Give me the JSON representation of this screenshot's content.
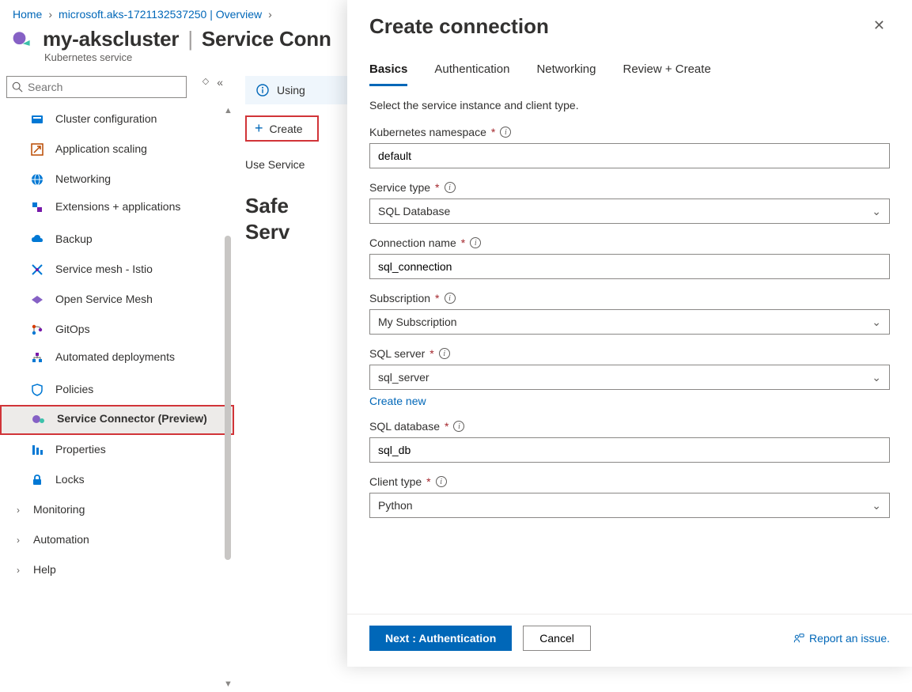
{
  "breadcrumb": {
    "home": "Home",
    "project": "microsoft.aks-1721132537250 | Overview"
  },
  "title": {
    "resource": "my-akscluster",
    "section": "Service Conn",
    "subtitle": "Kubernetes service"
  },
  "sidebar": {
    "search_placeholder": "Search",
    "items": [
      {
        "label": "Cluster configuration"
      },
      {
        "label": "Application scaling"
      },
      {
        "label": "Networking"
      },
      {
        "label": "Extensions + applications"
      },
      {
        "label": "Backup"
      },
      {
        "label": "Service mesh - Istio"
      },
      {
        "label": "Open Service Mesh"
      },
      {
        "label": "GitOps"
      },
      {
        "label": "Automated deployments"
      },
      {
        "label": "Policies"
      },
      {
        "label": "Service Connector (Preview)"
      },
      {
        "label": "Properties"
      },
      {
        "label": "Locks"
      }
    ],
    "groups": [
      {
        "label": "Monitoring"
      },
      {
        "label": "Automation"
      },
      {
        "label": "Help"
      }
    ]
  },
  "main": {
    "info_text": "Using",
    "create_label": "Create",
    "use_line": "Use Service ",
    "headline1": "Safe",
    "headline2": "Serv"
  },
  "panel": {
    "title": "Create connection",
    "tabs": [
      "Basics",
      "Authentication",
      "Networking",
      "Review + Create"
    ],
    "instruction": "Select the service instance and client type.",
    "fields": {
      "namespace": {
        "label": "Kubernetes namespace",
        "value": "default"
      },
      "service_type": {
        "label": "Service type",
        "value": "SQL Database"
      },
      "connection_name": {
        "label": "Connection name",
        "value": "sql_connection"
      },
      "subscription": {
        "label": "Subscription",
        "value": "My Subscription"
      },
      "sql_server": {
        "label": "SQL server",
        "value": "sql_server",
        "create_new": "Create new"
      },
      "sql_database": {
        "label": "SQL database",
        "value": "sql_db"
      },
      "client_type": {
        "label": "Client type",
        "value": "Python"
      }
    },
    "footer": {
      "next": "Next : Authentication",
      "cancel": "Cancel",
      "report": "Report an issue."
    }
  }
}
